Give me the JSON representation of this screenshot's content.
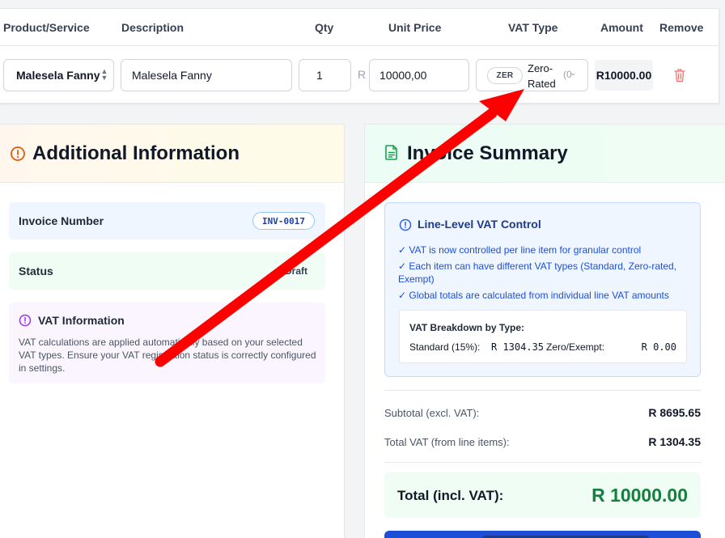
{
  "table": {
    "headers": {
      "product": "Product/Service",
      "description": "Description",
      "qty": "Qty",
      "unit_price": "Unit Price",
      "vat_type": "VAT Type",
      "amount": "Amount",
      "remove": "Remove"
    },
    "row": {
      "product": "Malesela Fanny",
      "description": "Malesela Fanny",
      "qty": "1",
      "currency": "R",
      "unit_price": "10000,00",
      "vat_badge": "ZER",
      "vat_label": "Zero-Rated",
      "vat_extra": "(0",
      "amount": "R10000.00"
    }
  },
  "additional": {
    "title": "Additional Information",
    "invoice_number_label": "Invoice Number",
    "invoice_number": "INV-0017",
    "status_label": "Status",
    "status_value": "Draft",
    "vat_info_title": "VAT Information",
    "vat_info_text": "VAT calculations are applied automatically based on your selected VAT types. Ensure your VAT registration status is correctly configured in settings."
  },
  "summary": {
    "title": "Invoice Summary",
    "control_title": "Line-Level VAT Control",
    "control_points": [
      "✓ VAT is now controlled per line item for granular control",
      "✓ Each item can have different VAT types (Standard, Zero-rated, Exempt)",
      "✓ Global totals are calculated from individual line VAT amounts"
    ],
    "breakdown_title": "VAT Breakdown by Type:",
    "standard_label": "Standard (15%):",
    "standard_value": "R 1304.35",
    "zero_label": "Zero/Exempt:",
    "zero_value": "R 0.00",
    "subtotal_label": "Subtotal (excl. VAT):",
    "subtotal_value": "R 8695.65",
    "total_vat_label": "Total VAT (from line items):",
    "total_vat_value": "R 1304.35",
    "total_label": "Total (incl. VAT):",
    "total_value": "R 10000.00"
  },
  "colors": {
    "annotation_arrow": "#ff0000",
    "total_green": "#15803d",
    "trash_red": "#f87171"
  }
}
